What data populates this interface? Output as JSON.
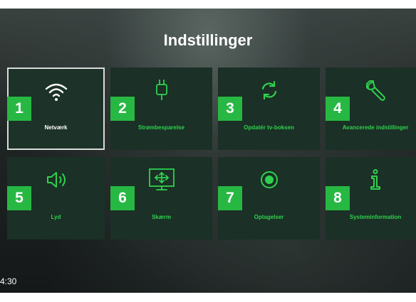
{
  "header": {
    "title": "Indstillinger"
  },
  "tiles": [
    {
      "number": "1",
      "label": "Netværk",
      "icon": "wifi-icon"
    },
    {
      "number": "2",
      "label": "Strømbesparelse",
      "icon": "power-plug-icon"
    },
    {
      "number": "3",
      "label": "Opdatér tv-boksen",
      "icon": "refresh-icon"
    },
    {
      "number": "4",
      "label": "Avancerede indstillinger",
      "icon": "wrench-icon"
    },
    {
      "number": "5",
      "label": "Lyd",
      "icon": "speaker-icon"
    },
    {
      "number": "6",
      "label": "Skærm",
      "icon": "screen-resize-icon"
    },
    {
      "number": "7",
      "label": "Optagelser",
      "icon": "record-icon"
    },
    {
      "number": "8",
      "label": "Systeminformation",
      "icon": "info-icon"
    }
  ],
  "status": {
    "time": "4:30"
  },
  "colors": {
    "accent": "#27b843",
    "label_green": "#2fd14e",
    "tile_bg": "#1b3026"
  }
}
